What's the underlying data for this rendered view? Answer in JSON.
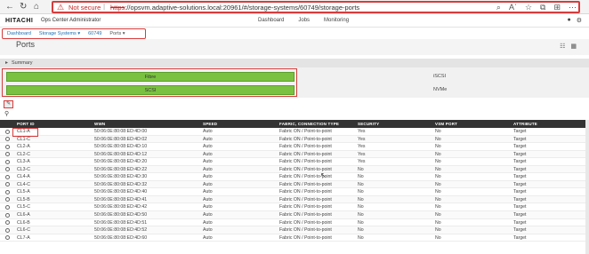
{
  "browser": {
    "not_secure": "Not secure",
    "url_scheme": "https",
    "url_rest": "://opsvm.adaptive-solutions.local:20961/#/storage-systems/60749/storage-ports"
  },
  "app": {
    "logo": "HITACHI",
    "title": "Ops Center Administrator",
    "nav": [
      "Dashboard",
      "Jobs",
      "Monitoring"
    ]
  },
  "breadcrumb": [
    "Dashboard",
    "Storage Systems ▾",
    "60749",
    "Ports ▾"
  ],
  "page": {
    "title": "Ports"
  },
  "summary": {
    "label": "Summary",
    "green_bars": [
      "Fibre",
      "SCSI"
    ],
    "protocols": [
      "iSCSI",
      "NVMe"
    ]
  },
  "table": {
    "columns": [
      "PORT ID",
      "WWN",
      "SPEED",
      "FABRIC, CONNECTION TYPE",
      "SECURITY",
      "VSM PORT",
      "ATTRIBUTE"
    ],
    "rows": [
      [
        "CL1-A",
        "50:06:0E:80:08:ED:4D:00",
        "Auto",
        "Fabric ON / Point-to-point",
        "Yes",
        "No",
        "Target"
      ],
      [
        "CL1-C",
        "50:06:0E:80:08:ED:4D:02",
        "Auto",
        "Fabric ON / Point-to-point",
        "Yes",
        "No",
        "Target"
      ],
      [
        "CL2-A",
        "50:06:0E:80:08:ED:4D:10",
        "Auto",
        "Fabric ON / Point-to-point",
        "Yes",
        "No",
        "Target"
      ],
      [
        "CL2-C",
        "50:06:0E:80:08:ED:4D:12",
        "Auto",
        "Fabric ON / Point-to-point",
        "Yes",
        "No",
        "Target"
      ],
      [
        "CL3-A",
        "50:06:0E:80:08:ED:4D:20",
        "Auto",
        "Fabric ON / Point-to-point",
        "Yes",
        "No",
        "Target"
      ],
      [
        "CL3-C",
        "50:06:0E:80:08:ED:4D:22",
        "Auto",
        "Fabric ON / Point-to-point",
        "No",
        "No",
        "Target"
      ],
      [
        "CL4-A",
        "50:06:0E:80:08:ED:4D:30",
        "Auto",
        "Fabric ON / Point-to-point",
        "No",
        "No",
        "Target"
      ],
      [
        "CL4-C",
        "50:06:0E:80:08:ED:4D:32",
        "Auto",
        "Fabric ON / Point-to-point",
        "No",
        "No",
        "Target"
      ],
      [
        "CL5-A",
        "50:06:0E:80:08:ED:4D:40",
        "Auto",
        "Fabric ON / Point-to-point",
        "No",
        "No",
        "Target"
      ],
      [
        "CL5-B",
        "50:06:0E:80:08:ED:4D:41",
        "Auto",
        "Fabric ON / Point-to-point",
        "No",
        "No",
        "Target"
      ],
      [
        "CL5-C",
        "50:06:0E:80:08:ED:4D:42",
        "Auto",
        "Fabric ON / Point-to-point",
        "No",
        "No",
        "Target"
      ],
      [
        "CL6-A",
        "50:06:0E:80:08:ED:4D:50",
        "Auto",
        "Fabric ON / Point-to-point",
        "No",
        "No",
        "Target"
      ],
      [
        "CL6-B",
        "50:06:0E:80:08:ED:4D:51",
        "Auto",
        "Fabric ON / Point-to-point",
        "No",
        "No",
        "Target"
      ],
      [
        "CL6-C",
        "50:06:0E:80:08:ED:4D:52",
        "Auto",
        "Fabric ON / Point-to-point",
        "No",
        "No",
        "Target"
      ],
      [
        "CL7-A",
        "50:06:0E:80:08:ED:4D:60",
        "Auto",
        "Fabric ON / Point-to-point",
        "No",
        "No",
        "Target"
      ]
    ]
  },
  "colors": {
    "highlight": "#d63c3c",
    "green": "#7ac142",
    "header": "#333333"
  }
}
